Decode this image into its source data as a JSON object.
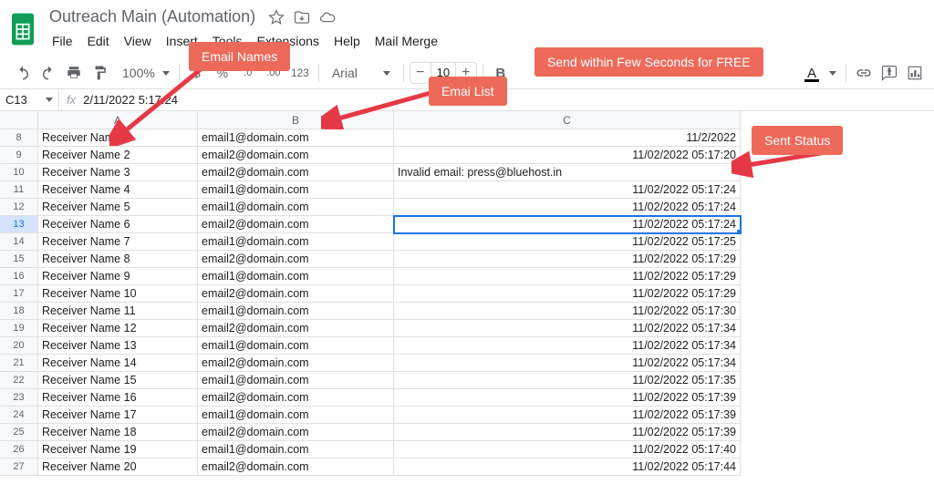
{
  "doc_title": "Outreach Main (Automation)",
  "menus": [
    "File",
    "Edit",
    "View",
    "Insert",
    "Tools",
    "Extensions",
    "Help",
    "Mail Merge"
  ],
  "toolbar": {
    "zoom": "100%",
    "currency": "$",
    "percent": "%",
    "dec_dec": ".0",
    "dec_inc": ".00",
    "format_123": "123",
    "font": "Arial",
    "font_size": "10",
    "bold": "B",
    "text_color_A": "A"
  },
  "name_box": "C13",
  "fx_label": "fx",
  "fx_value": "2/11/2022 5:17:24",
  "col_headers": [
    "",
    "A",
    "B",
    "C"
  ],
  "rows": [
    {
      "n": "8",
      "a": "Receiver Name 1",
      "b": "email1@domain.com",
      "c": "11/2/2022",
      "r": true
    },
    {
      "n": "9",
      "a": "Receiver Name 2",
      "b": "email2@domain.com",
      "c": "11/02/2022 05:17:20",
      "r": true
    },
    {
      "n": "10",
      "a": "Receiver Name 3",
      "b": "email2@domain.com",
      "c": "Invalid email: press@bluehost.in",
      "r": false
    },
    {
      "n": "11",
      "a": "Receiver Name 4",
      "b": "email1@domain.com",
      "c": "11/02/2022 05:17:24",
      "r": true
    },
    {
      "n": "12",
      "a": "Receiver Name 5",
      "b": "email1@domain.com",
      "c": "11/02/2022 05:17:24",
      "r": true
    },
    {
      "n": "13",
      "a": "Receiver Name 6",
      "b": "email2@domain.com",
      "c": "11/02/2022 05:17:24",
      "r": true,
      "sel": true
    },
    {
      "n": "14",
      "a": "Receiver Name 7",
      "b": "email1@domain.com",
      "c": "11/02/2022 05:17:25",
      "r": true
    },
    {
      "n": "15",
      "a": "Receiver Name 8",
      "b": "email2@domain.com",
      "c": "11/02/2022 05:17:29",
      "r": true
    },
    {
      "n": "16",
      "a": "Receiver Name 9",
      "b": "email1@domain.com",
      "c": "11/02/2022 05:17:29",
      "r": true
    },
    {
      "n": "17",
      "a": "Receiver Name 10",
      "b": "email2@domain.com",
      "c": "11/02/2022 05:17:29",
      "r": true
    },
    {
      "n": "18",
      "a": "Receiver Name 11",
      "b": "email1@domain.com",
      "c": "11/02/2022 05:17:30",
      "r": true
    },
    {
      "n": "19",
      "a": "Receiver Name 12",
      "b": "email2@domain.com",
      "c": "11/02/2022 05:17:34",
      "r": true
    },
    {
      "n": "20",
      "a": "Receiver Name 13",
      "b": "email1@domain.com",
      "c": "11/02/2022 05:17:34",
      "r": true
    },
    {
      "n": "21",
      "a": "Receiver Name 14",
      "b": "email2@domain.com",
      "c": "11/02/2022 05:17:34",
      "r": true
    },
    {
      "n": "22",
      "a": "Receiver Name 15",
      "b": "email1@domain.com",
      "c": "11/02/2022 05:17:35",
      "r": true
    },
    {
      "n": "23",
      "a": "Receiver Name 16",
      "b": "email2@domain.com",
      "c": "11/02/2022 05:17:39",
      "r": true
    },
    {
      "n": "24",
      "a": "Receiver Name 17",
      "b": "email1@domain.com",
      "c": "11/02/2022 05:17:39",
      "r": true
    },
    {
      "n": "25",
      "a": "Receiver Name 18",
      "b": "email2@domain.com",
      "c": "11/02/2022 05:17:39",
      "r": true
    },
    {
      "n": "26",
      "a": "Receiver Name 19",
      "b": "email1@domain.com",
      "c": "11/02/2022 05:17:40",
      "r": true
    },
    {
      "n": "27",
      "a": "Receiver Name 20",
      "b": "email2@domain.com",
      "c": "11/02/2022 05:17:44",
      "r": true
    }
  ],
  "callouts": {
    "email_names": "Email Names",
    "email_list": "Emai List",
    "send_free": "Send within Few Seconds for FREE",
    "sent_status": "Sent Status"
  }
}
